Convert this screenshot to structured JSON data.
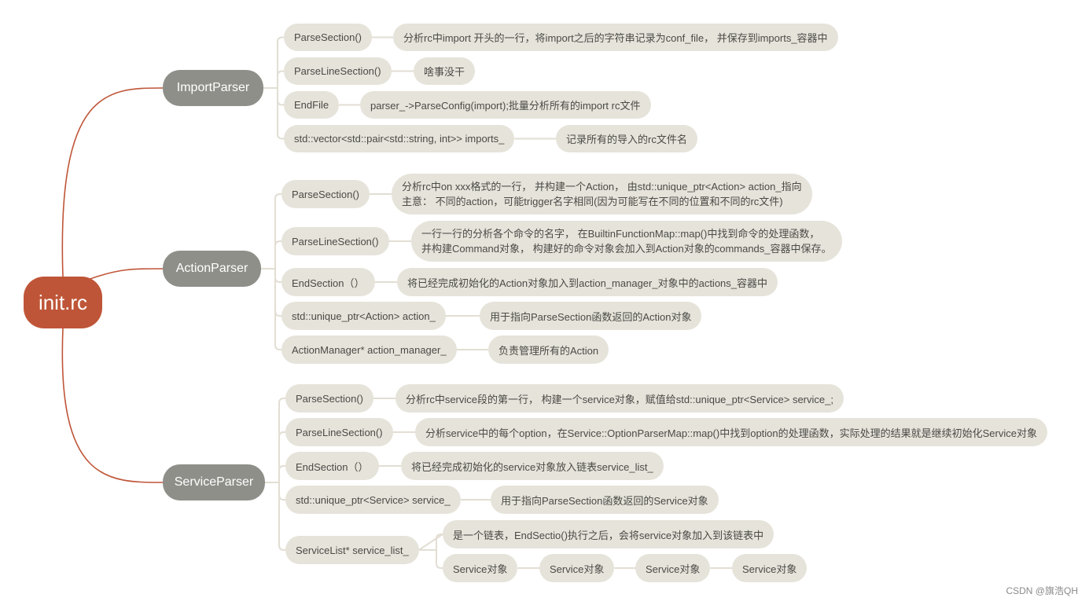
{
  "root": {
    "label": "init.rc",
    "color": "#bf5538"
  },
  "colors": {
    "main_node": "#8f8f8a",
    "leaf_node": "#e6e3da",
    "root_link": "#bf5538",
    "branch_link": "#e2ded3"
  },
  "parsers": [
    {
      "label": "ImportParser",
      "items": [
        {
          "label": "ParseSection()",
          "desc": [
            "分析rc中import 开头的一行，将import之后的字符串记录为conf_file， 并保存到imports_容器中"
          ]
        },
        {
          "label": "ParseLineSection()",
          "desc": [
            "啥事没干"
          ]
        },
        {
          "label": "EndFile",
          "desc": [
            "parser_->ParseConfig(import);批量分析所有的import rc文件"
          ]
        },
        {
          "label": "std::vector<std::pair<std::string, int>> imports_",
          "desc": [
            "记录所有的导入的rc文件名"
          ]
        }
      ]
    },
    {
      "label": "ActionParser",
      "items": [
        {
          "label": "ParseSection()",
          "desc": [
            "分析rc中on xxx格式的一行， 并构建一个Action， 由std::unique_ptr<Action> action_指向",
            "主意： 不同的action，可能trigger名字相同(因为可能写在不同的位置和不同的rc文件)"
          ]
        },
        {
          "label": "ParseLineSection()",
          "desc": [
            "一行一行的分析各个命令的名字， 在BuiltinFunctionMap::map()中找到命令的处理函数，",
            "并构建Command对象， 构建好的命令对象会加入到Action对象的commands_容器中保存。"
          ]
        },
        {
          "label": "EndSection（）",
          "desc": [
            "将已经完成初始化的Action对象加入到action_manager_对象中的actions_容器中"
          ]
        },
        {
          "label": "std::unique_ptr<Action> action_",
          "desc": [
            "用于指向ParseSection函数返回的Action对象"
          ]
        },
        {
          "label": "ActionManager* action_manager_",
          "desc": [
            "负责管理所有的Action"
          ]
        }
      ]
    },
    {
      "label": "ServiceParser",
      "items": [
        {
          "label": "ParseSection()",
          "desc": [
            "分析rc中service段的第一行， 构建一个service对象，赋值给std::unique_ptr<Service> service_;"
          ]
        },
        {
          "label": "ParseLineSection()",
          "desc": [
            "分析service中的每个option，在Service::OptionParserMap::map()中找到option的处理函数，实际处理的结果就是继续初始化Service对象"
          ]
        },
        {
          "label": "EndSection（）",
          "desc": [
            "将已经完成初始化的service对象放入链表service_list_"
          ]
        },
        {
          "label": "std::unique_ptr<Service> service_",
          "desc": [
            "用于指向ParseSection函数返回的Service对象"
          ]
        },
        {
          "label": "ServiceList* service_list_",
          "desc": [
            "是一个链表，EndSectio()执行之后，会将service对象加入到该链表中"
          ],
          "chain": [
            "Service对象",
            "Service对象",
            "Service对象",
            "Service对象"
          ]
        }
      ]
    }
  ],
  "watermark": "CSDN @旗浩QH"
}
